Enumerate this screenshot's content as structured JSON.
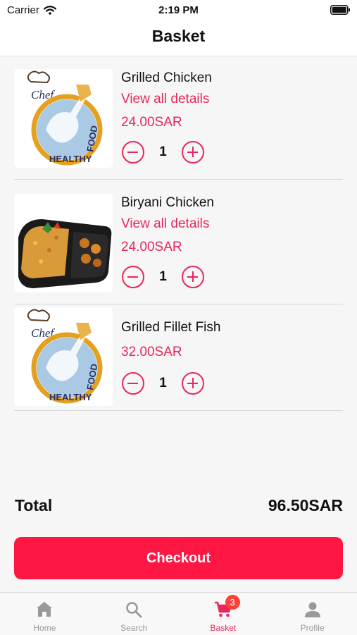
{
  "status": {
    "carrier": "Carrier",
    "time": "2:19 PM"
  },
  "header": {
    "title": "Basket"
  },
  "logo_text": {
    "chef": "Chef",
    "healthy": "HEALTHY",
    "food": "FOOD"
  },
  "items": [
    {
      "name": "Grilled Chicken",
      "link": "View all details",
      "price": "24.00SAR",
      "qty": "1",
      "image": "chef-healthy-food-logo"
    },
    {
      "name": "Biryani Chicken",
      "link": "View all details",
      "price": "24.00SAR",
      "qty": "1",
      "image": "biryani-meal-photo"
    },
    {
      "name": "Grilled Fillet Fish",
      "price": "32.00SAR",
      "qty": "1",
      "image": "chef-healthy-food-logo"
    }
  ],
  "summary": {
    "total_label": "Total",
    "total_value": "96.50SAR"
  },
  "checkout": {
    "label": "Checkout"
  },
  "tabs": [
    {
      "label": "Home",
      "icon": "home-icon"
    },
    {
      "label": "Search",
      "icon": "search-icon"
    },
    {
      "label": "Basket",
      "icon": "cart-icon",
      "badge": "3",
      "active": true
    },
    {
      "label": "Profile",
      "icon": "person-icon"
    }
  ],
  "colors": {
    "accent": "#e8275a",
    "checkout": "#ff1744",
    "badge": "#ff4136"
  }
}
